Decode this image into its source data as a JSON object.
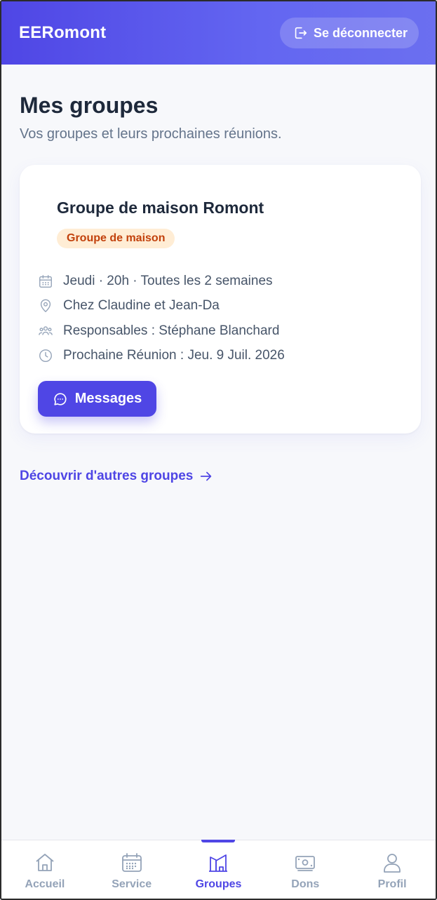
{
  "header": {
    "brand": "EERomont",
    "logout_label": "Se déconnecter"
  },
  "page": {
    "title": "Mes groupes",
    "subtitle": "Vos groupes et leurs prochaines réunions."
  },
  "group_card": {
    "title": "Groupe de maison Romont",
    "badge": "Groupe de maison",
    "schedule": "Jeudi · 20h · Toutes les 2 semaines",
    "location": "Chez Claudine et Jean-Da",
    "leaders": "Responsables : Stéphane Blanchard",
    "next_meeting": "Prochaine Réunion : Jeu. 9 Juil. 2026",
    "messages_label": "Messages"
  },
  "discover_label": "Découvrir d'autres groupes",
  "bottom_nav": {
    "items": [
      {
        "label": "Accueil",
        "icon": "home-icon"
      },
      {
        "label": "Service",
        "icon": "calendar-icon"
      },
      {
        "label": "Groupes",
        "icon": "buildings-icon"
      },
      {
        "label": "Dons",
        "icon": "banknote-icon"
      },
      {
        "label": "Profil",
        "icon": "user-icon"
      }
    ],
    "active": "Groupes"
  },
  "colors": {
    "accent": "#4f46e5",
    "badge_bg": "#ffedd5",
    "badge_text": "#c2410c",
    "muted": "#94a3b8"
  }
}
